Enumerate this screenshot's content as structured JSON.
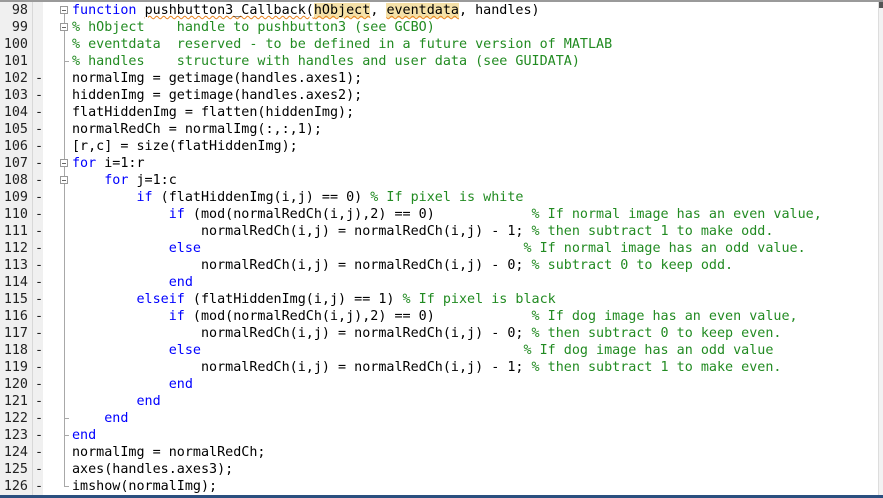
{
  "editor": {
    "lines": [
      {
        "n": "98",
        "dash": "",
        "segs": [
          {
            "t": "function",
            "c": "kw"
          },
          {
            "t": " ",
            "c": ""
          },
          {
            "t": "pushbutton3_Callback(",
            "c": "err"
          },
          {
            "t": "hObject",
            "c": "hl"
          },
          {
            "t": ", ",
            "c": ""
          },
          {
            "t": "eventdata",
            "c": "hl"
          },
          {
            "t": ", handles)",
            "c": ""
          }
        ]
      },
      {
        "n": "99",
        "dash": "",
        "segs": [
          {
            "t": "% hObject    handle to pushbutton3 (see GCBO)",
            "c": "cm"
          }
        ]
      },
      {
        "n": "100",
        "dash": "",
        "segs": [
          {
            "t": "% eventdata  reserved - to be defined in a future version of MATLAB",
            "c": "cm"
          }
        ]
      },
      {
        "n": "101",
        "dash": "",
        "segs": [
          {
            "t": "% handles    structure with handles and user data (see GUIDATA)",
            "c": "cm"
          }
        ]
      },
      {
        "n": "102",
        "dash": "-",
        "segs": [
          {
            "t": "normalImg = getimage(handles.axes1);",
            "c": ""
          }
        ]
      },
      {
        "n": "103",
        "dash": "-",
        "segs": [
          {
            "t": "hiddenImg = getimage(handles.axes2);",
            "c": ""
          }
        ]
      },
      {
        "n": "104",
        "dash": "-",
        "segs": [
          {
            "t": "flatHiddenImg = flatten(hiddenImg);",
            "c": ""
          }
        ]
      },
      {
        "n": "105",
        "dash": "-",
        "segs": [
          {
            "t": "normalRedCh = normalImg(:,:,1);",
            "c": ""
          }
        ]
      },
      {
        "n": "106",
        "dash": "-",
        "segs": [
          {
            "t": "[r,c] = size(flatHiddenImg);",
            "c": ""
          }
        ]
      },
      {
        "n": "107",
        "dash": "-",
        "segs": [
          {
            "t": "for",
            "c": "kw"
          },
          {
            "t": " i=1:r",
            "c": ""
          }
        ]
      },
      {
        "n": "108",
        "dash": "-",
        "segs": [
          {
            "t": "    ",
            "c": ""
          },
          {
            "t": "for",
            "c": "kw"
          },
          {
            "t": " j=1:c",
            "c": ""
          }
        ]
      },
      {
        "n": "109",
        "dash": "-",
        "segs": [
          {
            "t": "        ",
            "c": ""
          },
          {
            "t": "if",
            "c": "kw"
          },
          {
            "t": " (flatHiddenImg(i,j) == 0) ",
            "c": ""
          },
          {
            "t": "% If pixel is white",
            "c": "cm"
          }
        ]
      },
      {
        "n": "110",
        "dash": "-",
        "segs": [
          {
            "t": "            ",
            "c": ""
          },
          {
            "t": "if",
            "c": "kw"
          },
          {
            "t": " (mod(normalRedCh(i,j),2) == 0)            ",
            "c": ""
          },
          {
            "t": "% If normal image has an even value,",
            "c": "cm"
          }
        ]
      },
      {
        "n": "111",
        "dash": "-",
        "segs": [
          {
            "t": "                normalRedCh(i,j) = normalRedCh(i,j) - 1; ",
            "c": ""
          },
          {
            "t": "% then subtract 1 to make odd.",
            "c": "cm"
          }
        ]
      },
      {
        "n": "112",
        "dash": "-",
        "segs": [
          {
            "t": "            ",
            "c": ""
          },
          {
            "t": "else",
            "c": "kw"
          },
          {
            "t": "                                        ",
            "c": ""
          },
          {
            "t": "% If normal image has an odd value.",
            "c": "cm"
          }
        ]
      },
      {
        "n": "113",
        "dash": "-",
        "segs": [
          {
            "t": "                normalRedCh(i,j) = normalRedCh(i,j) - 0; ",
            "c": ""
          },
          {
            "t": "% subtract 0 to keep odd.",
            "c": "cm"
          }
        ]
      },
      {
        "n": "114",
        "dash": "-",
        "segs": [
          {
            "t": "            ",
            "c": ""
          },
          {
            "t": "end",
            "c": "kw"
          }
        ]
      },
      {
        "n": "115",
        "dash": "-",
        "segs": [
          {
            "t": "        ",
            "c": ""
          },
          {
            "t": "elseif",
            "c": "kw"
          },
          {
            "t": " (flatHiddenImg(i,j) == 1) ",
            "c": ""
          },
          {
            "t": "% If pixel is black",
            "c": "cm"
          }
        ]
      },
      {
        "n": "116",
        "dash": "-",
        "segs": [
          {
            "t": "            ",
            "c": ""
          },
          {
            "t": "if",
            "c": "kw"
          },
          {
            "t": " (mod(normalRedCh(i,j),2) == 0)            ",
            "c": ""
          },
          {
            "t": "% If dog image has an even value,",
            "c": "cm"
          }
        ]
      },
      {
        "n": "117",
        "dash": "-",
        "segs": [
          {
            "t": "                normalRedCh(i,j) = normalRedCh(i,j) - 0; ",
            "c": ""
          },
          {
            "t": "% then subtract 0 to keep even.",
            "c": "cm"
          }
        ]
      },
      {
        "n": "118",
        "dash": "-",
        "segs": [
          {
            "t": "            ",
            "c": ""
          },
          {
            "t": "else",
            "c": "kw"
          },
          {
            "t": "                                        ",
            "c": ""
          },
          {
            "t": "% If dog image has an odd value",
            "c": "cm"
          }
        ]
      },
      {
        "n": "119",
        "dash": "-",
        "segs": [
          {
            "t": "                normalRedCh(i,j) = normalRedCh(i,j) - 1; ",
            "c": ""
          },
          {
            "t": "% then subtract 1 to make even.",
            "c": "cm"
          }
        ]
      },
      {
        "n": "120",
        "dash": "-",
        "segs": [
          {
            "t": "            ",
            "c": ""
          },
          {
            "t": "end",
            "c": "kw"
          }
        ]
      },
      {
        "n": "121",
        "dash": "-",
        "segs": [
          {
            "t": "        ",
            "c": ""
          },
          {
            "t": "end",
            "c": "kw"
          }
        ]
      },
      {
        "n": "122",
        "dash": "-",
        "segs": [
          {
            "t": "    ",
            "c": ""
          },
          {
            "t": "end",
            "c": "kw"
          }
        ]
      },
      {
        "n": "123",
        "dash": "-",
        "segs": [
          {
            "t": "end",
            "c": "kw"
          }
        ]
      },
      {
        "n": "124",
        "dash": "-",
        "segs": [
          {
            "t": "normalImg = normalRedCh;",
            "c": ""
          }
        ]
      },
      {
        "n": "125",
        "dash": "-",
        "segs": [
          {
            "t": "axes(handles.axes3);",
            "c": ""
          }
        ]
      },
      {
        "n": "126",
        "dash": "-",
        "segs": [
          {
            "t": "imshow(normalImg);",
            "c": ""
          }
        ]
      }
    ]
  }
}
